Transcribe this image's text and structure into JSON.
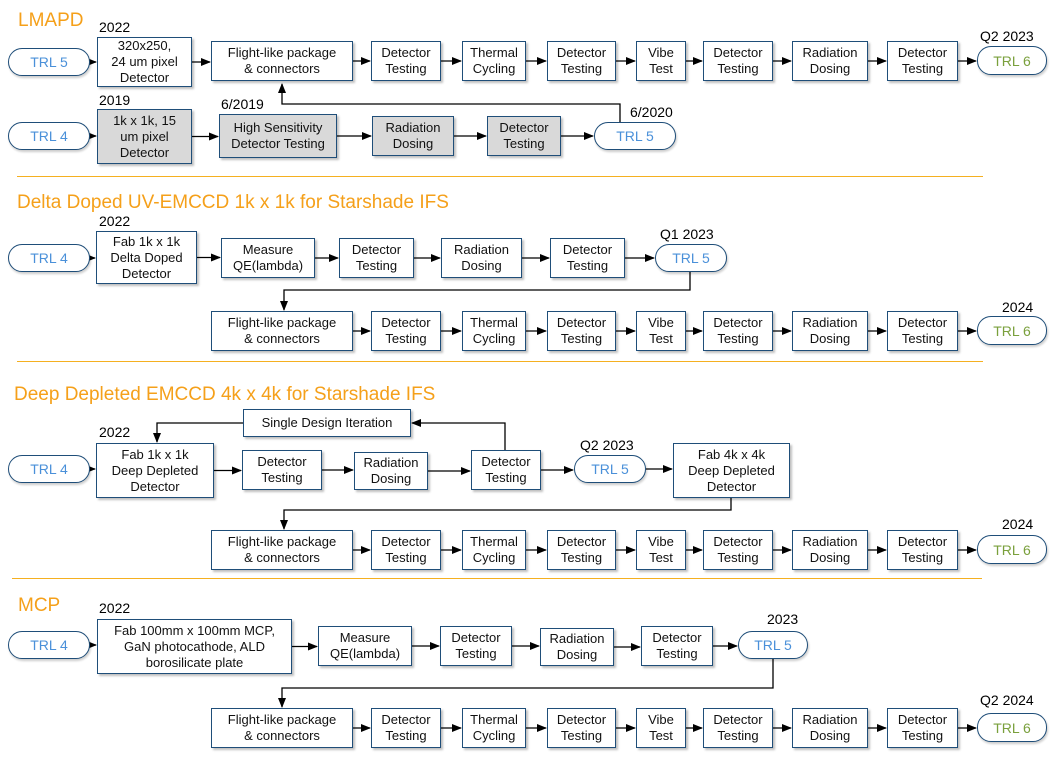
{
  "colors": {
    "accent_orange": "#f5a01a",
    "box_border": "#1f4e79",
    "trl_text": "#4a90d9",
    "trl6_text": "#7aa03c",
    "completed_fill": "#d9d9d9"
  },
  "sections": [
    {
      "title": "LMAPD",
      "labels": [
        "2022",
        "Q2 2023",
        "2019",
        "6/2019",
        "6/2020"
      ],
      "nodes": [
        {
          "lines": [
            "TRL 5"
          ],
          "type": "pill"
        },
        {
          "lines": [
            "320x250,",
            "24 um pixel",
            "Detector"
          ]
        },
        {
          "lines": [
            "Flight-like package",
            "& connectors"
          ]
        },
        {
          "lines": [
            "Detector",
            "Testing"
          ]
        },
        {
          "lines": [
            "Thermal",
            "Cycling"
          ]
        },
        {
          "lines": [
            "Detector",
            "Testing"
          ]
        },
        {
          "lines": [
            "Vibe",
            "Test"
          ]
        },
        {
          "lines": [
            "Detector",
            "Testing"
          ]
        },
        {
          "lines": [
            "Radiation",
            "Dosing"
          ]
        },
        {
          "lines": [
            "Detector",
            "Testing"
          ]
        },
        {
          "lines": [
            "TRL 6"
          ],
          "type": "final"
        },
        {
          "lines": [
            "TRL 4"
          ],
          "type": "pill"
        },
        {
          "lines": [
            "1k x 1k, 15",
            "um pixel",
            "Detector"
          ],
          "type": "gray"
        },
        {
          "lines": [
            "High Sensitivity",
            "Detector Testing"
          ],
          "type": "gray"
        },
        {
          "lines": [
            "Radiation",
            "Dosing"
          ],
          "type": "gray"
        },
        {
          "lines": [
            "Detector",
            "Testing"
          ],
          "type": "gray"
        },
        {
          "lines": [
            "TRL 5"
          ],
          "type": "pill"
        }
      ]
    },
    {
      "title": "Delta Doped UV-EMCCD 1k x 1k for Starshade IFS",
      "labels": [
        "2022",
        "Q1 2023",
        "2024"
      ],
      "nodes": [
        {
          "lines": [
            "TRL 4"
          ],
          "type": "pill"
        },
        {
          "lines": [
            "Fab 1k x 1k",
            "Delta Doped",
            "Detector"
          ]
        },
        {
          "lines": [
            "Measure",
            "QE(lambda)"
          ]
        },
        {
          "lines": [
            "Detector",
            "Testing"
          ]
        },
        {
          "lines": [
            "Radiation",
            "Dosing"
          ]
        },
        {
          "lines": [
            "Detector",
            "Testing"
          ]
        },
        {
          "lines": [
            "TRL 5"
          ],
          "type": "pill"
        },
        {
          "lines": [
            "Flight-like package",
            "& connectors"
          ]
        },
        {
          "lines": [
            "Detector",
            "Testing"
          ]
        },
        {
          "lines": [
            "Thermal",
            "Cycling"
          ]
        },
        {
          "lines": [
            "Detector",
            "Testing"
          ]
        },
        {
          "lines": [
            "Vibe",
            "Test"
          ]
        },
        {
          "lines": [
            "Detector",
            "Testing"
          ]
        },
        {
          "lines": [
            "Radiation",
            "Dosing"
          ]
        },
        {
          "lines": [
            "Detector",
            "Testing"
          ]
        },
        {
          "lines": [
            "TRL 6"
          ],
          "type": "final"
        }
      ]
    },
    {
      "title": "Deep Depleted EMCCD 4k x 4k for Starshade IFS",
      "labels": [
        "2022",
        "Q2 2023",
        "2024"
      ],
      "nodes": [
        {
          "lines": [
            "TRL 4"
          ],
          "type": "pill"
        },
        {
          "lines": [
            "Fab 1k x 1k",
            "Deep Depleted",
            "Detector"
          ]
        },
        {
          "lines": [
            "Detector",
            "Testing"
          ]
        },
        {
          "lines": [
            "Radiation",
            "Dosing"
          ]
        },
        {
          "lines": [
            "Detector",
            "Testing"
          ]
        },
        {
          "lines": [
            "TRL 5"
          ],
          "type": "pill"
        },
        {
          "lines": [
            "Fab 4k x 4k",
            "Deep Depleted",
            "Detector"
          ]
        },
        {
          "lines": [
            "Single  Design Iteration"
          ]
        },
        {
          "lines": [
            "Flight-like package",
            "& connectors"
          ]
        },
        {
          "lines": [
            "Detector",
            "Testing"
          ]
        },
        {
          "lines": [
            "Thermal",
            "Cycling"
          ]
        },
        {
          "lines": [
            "Detector",
            "Testing"
          ]
        },
        {
          "lines": [
            "Vibe",
            "Test"
          ]
        },
        {
          "lines": [
            "Detector",
            "Testing"
          ]
        },
        {
          "lines": [
            "Radiation",
            "Dosing"
          ]
        },
        {
          "lines": [
            "Detector",
            "Testing"
          ]
        },
        {
          "lines": [
            "TRL 6"
          ],
          "type": "final"
        }
      ]
    },
    {
      "title": "MCP",
      "labels": [
        "2022",
        "2023",
        "Q2 2024"
      ],
      "nodes": [
        {
          "lines": [
            "TRL 4"
          ],
          "type": "pill"
        },
        {
          "lines": [
            "Fab 100mm x 100mm MCP,",
            "GaN photocathode, ALD",
            "borosilicate plate"
          ]
        },
        {
          "lines": [
            "Measure",
            "QE(lambda)"
          ]
        },
        {
          "lines": [
            "Detector",
            "Testing"
          ]
        },
        {
          "lines": [
            "Radiation",
            "Dosing"
          ]
        },
        {
          "lines": [
            "Detector",
            "Testing"
          ]
        },
        {
          "lines": [
            "TRL 5"
          ],
          "type": "pill"
        },
        {
          "lines": [
            "Flight-like package",
            "& connectors"
          ]
        },
        {
          "lines": [
            "Detector",
            "Testing"
          ]
        },
        {
          "lines": [
            "Thermal",
            "Cycling"
          ]
        },
        {
          "lines": [
            "Detector",
            "Testing"
          ]
        },
        {
          "lines": [
            "Vibe",
            "Test"
          ]
        },
        {
          "lines": [
            "Detector",
            "Testing"
          ]
        },
        {
          "lines": [
            "Radiation",
            "Dosing"
          ]
        },
        {
          "lines": [
            "Detector",
            "Testing"
          ]
        },
        {
          "lines": [
            "TRL 6"
          ],
          "type": "final"
        }
      ]
    }
  ]
}
